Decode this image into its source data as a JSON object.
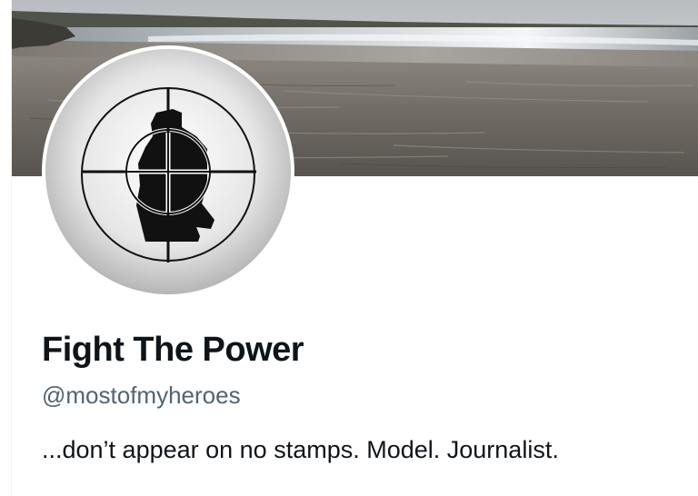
{
  "profile": {
    "display_name": "Fight The Power",
    "handle": "@mostofmyheroes",
    "bio": "...don’t appear on no stamps. Model. Journalist."
  },
  "banner": {
    "depiction": "beach-seascape-photo"
  },
  "avatar": {
    "depiction": "crosshair-silhouette-logo"
  },
  "colors": {
    "name_text": "#0f1419",
    "handle_text": "#536471",
    "background": "#ffffff"
  }
}
